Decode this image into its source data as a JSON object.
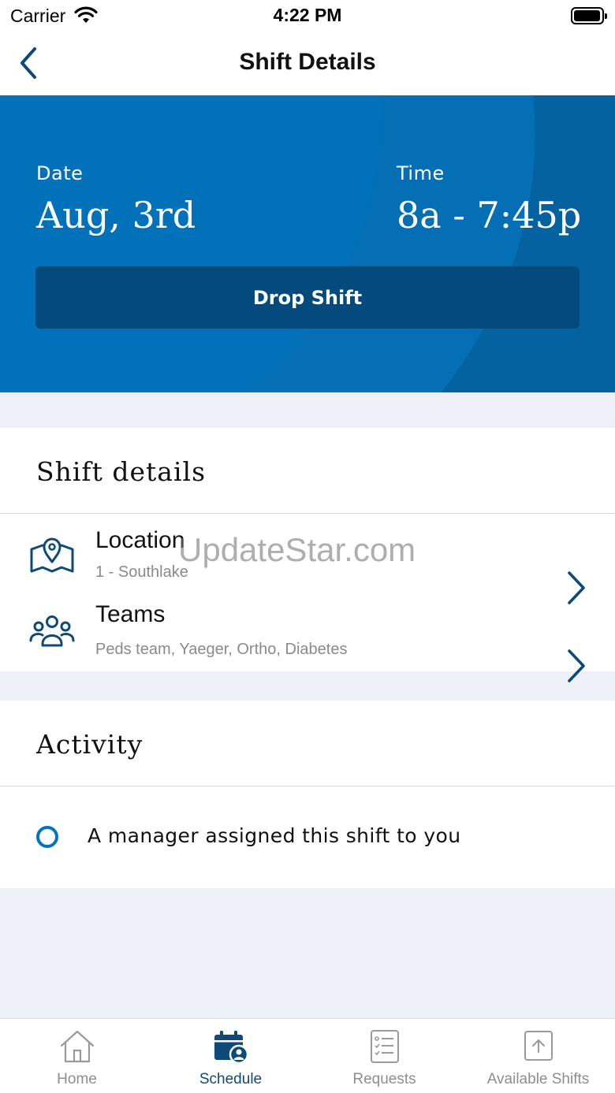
{
  "status_bar": {
    "carrier": "Carrier",
    "time": "4:22 PM"
  },
  "nav": {
    "title": "Shift Details"
  },
  "hero": {
    "date_label": "Date",
    "date_value": "Aug, 3rd",
    "time_label": "Time",
    "time_value": "8a - 7:45p",
    "drop_button": "Drop Shift"
  },
  "shift_details": {
    "title": "Shift details",
    "location": {
      "label": "Location",
      "value": "1 - Southlake"
    },
    "teams": {
      "label": "Teams",
      "value": "Peds team, Yaeger, Ortho, Diabetes"
    }
  },
  "watermark": "UpdateStar.com",
  "activity": {
    "title": "Activity",
    "items": [
      {
        "text": "A manager assigned this shift to you"
      }
    ]
  },
  "tabs": [
    {
      "label": "Home",
      "icon": "home-icon",
      "active": false
    },
    {
      "label": "Schedule",
      "icon": "calendar-user-icon",
      "active": true
    },
    {
      "label": "Requests",
      "icon": "checklist-icon",
      "active": false
    },
    {
      "label": "Available Shifts",
      "icon": "upload-icon",
      "active": false
    }
  ],
  "colors": {
    "accent": "#0171b9",
    "drop_button": "#044a7c",
    "icon_blue": "#0d4a7a",
    "background": "#edf0f7"
  }
}
